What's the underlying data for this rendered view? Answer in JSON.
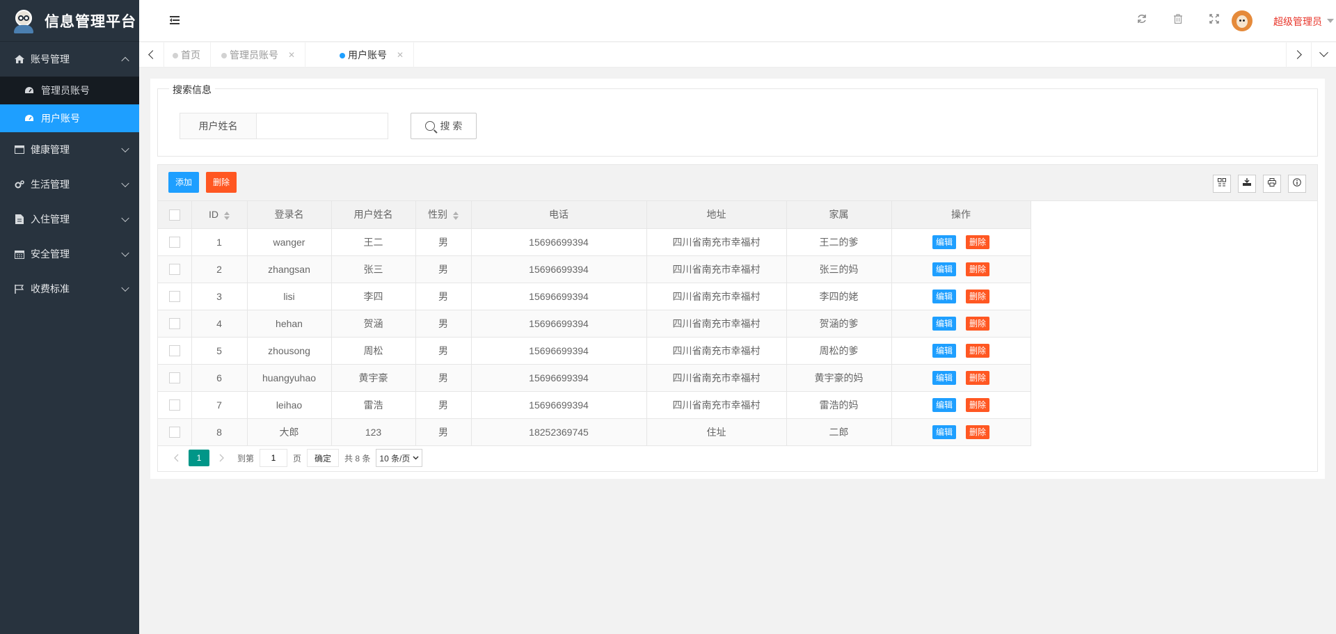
{
  "app": {
    "title": "信息管理平台"
  },
  "sidebar": {
    "groups": [
      {
        "label": "账号管理",
        "icon": "home-icon",
        "expanded": true,
        "children": [
          {
            "label": "管理员账号",
            "icon": "dashboard-icon"
          },
          {
            "label": "用户账号",
            "icon": "dashboard-icon",
            "active": true
          }
        ]
      },
      {
        "label": "健康管理",
        "icon": "window-icon"
      },
      {
        "label": "生活管理",
        "icon": "gears-icon"
      },
      {
        "label": "入住管理",
        "icon": "document-icon"
      },
      {
        "label": "安全管理",
        "icon": "calendar-icon"
      },
      {
        "label": "收费标准",
        "icon": "flag-icon"
      }
    ]
  },
  "header": {
    "user_name": "超级管理员",
    "icons": [
      "refresh-icon",
      "trash-icon",
      "fullscreen-icon"
    ]
  },
  "tabs": {
    "items": [
      {
        "label": "首页",
        "closable": false
      },
      {
        "label": "管理员账号",
        "closable": true
      },
      {
        "label": "用户账号",
        "closable": true,
        "active": true
      }
    ],
    "close_glyph": "✕"
  },
  "search": {
    "legend": "搜索信息",
    "field_label": "用户姓名",
    "field_value": "",
    "button_label": "搜 索"
  },
  "toolbar": {
    "add_label": "添加",
    "delete_label": "删除"
  },
  "table": {
    "columns": [
      "ID",
      "登录名",
      "用户姓名",
      "性别",
      "电话",
      "地址",
      "家属",
      "操作"
    ],
    "rows": [
      [
        "1",
        "wanger",
        "王二",
        "男",
        "15696699394",
        "四川省南充市幸福村",
        "王二的爹"
      ],
      [
        "2",
        "zhangsan",
        "张三",
        "男",
        "15696699394",
        "四川省南充市幸福村",
        "张三的妈"
      ],
      [
        "3",
        "lisi",
        "李四",
        "男",
        "15696699394",
        "四川省南充市幸福村",
        "李四的姥"
      ],
      [
        "4",
        "hehan",
        "贺涵",
        "男",
        "15696699394",
        "四川省南充市幸福村",
        "贺涵的爹"
      ],
      [
        "5",
        "zhousong",
        "周松",
        "男",
        "15696699394",
        "四川省南充市幸福村",
        "周松的爹"
      ],
      [
        "6",
        "huangyuhao",
        "黄宇豪",
        "男",
        "15696699394",
        "四川省南充市幸福村",
        "黄宇豪的妈"
      ],
      [
        "7",
        "leihao",
        "雷浩",
        "男",
        "15696699394",
        "四川省南充市幸福村",
        "雷浩的妈"
      ],
      [
        "8",
        "大郎",
        "123",
        "男",
        "18252369745",
        "住址",
        "二郎"
      ]
    ],
    "edit_label": "编辑",
    "delete_label": "删除"
  },
  "pager": {
    "current": "1",
    "goto_label": "到第",
    "goto_value": "1",
    "page_unit": "页",
    "confirm_label": "确定",
    "total_text": "共 8 条",
    "page_size": "10 条/页"
  },
  "colors": {
    "sidebar_bg": "#28333e",
    "accent_blue": "#1e9fff",
    "danger_orange": "#ff5722",
    "pager_green": "#009688",
    "user_red": "#e8352a"
  }
}
